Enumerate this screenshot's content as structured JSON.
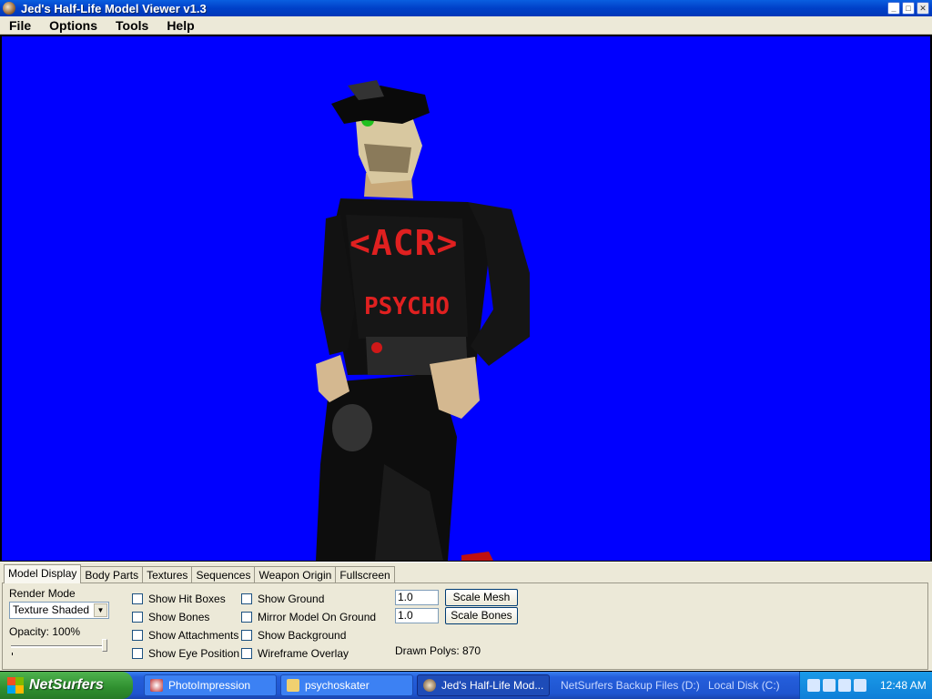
{
  "window": {
    "title": "Jed's Half-Life Model Viewer v1.3"
  },
  "menu": [
    "File",
    "Options",
    "Tools",
    "Help"
  ],
  "tabs": [
    "Model Display",
    "Body Parts",
    "Textures",
    "Sequences",
    "Weapon Origin",
    "Fullscreen"
  ],
  "model_display": {
    "render_mode_label": "Render Mode",
    "render_mode_value": "Texture Shaded",
    "opacity_label": "Opacity: 100%",
    "opacity": 1.0,
    "checkboxes_col1": [
      "Show Hit Boxes",
      "Show Bones",
      "Show Attachments",
      "Show Eye Position"
    ],
    "checkboxes_col2": [
      "Show Ground",
      "Mirror Model On Ground",
      "Show Background",
      "Wireframe Overlay"
    ],
    "scale_mesh_value": "1.0",
    "scale_bones_value": "1.0",
    "scale_mesh_button": "Scale Mesh",
    "scale_bones_button": "Scale Bones",
    "drawn_polys": "Drawn Polys: 870"
  },
  "model_texture_text": {
    "shirt_top": "<ACR>",
    "shirt_bottom": "PSYCHO"
  },
  "taskbar": {
    "start": "NetSurfers",
    "tasks": [
      "PhotoImpression",
      "psychoskater",
      "Jed's Half-Life Mod..."
    ],
    "links": [
      "NetSurfers Backup Files (D:)",
      "Local Disk (C:)"
    ],
    "time": "12:48 AM"
  },
  "colors": {
    "viewport_bg": "#0000ff",
    "title_bar": "#0050d8",
    "panel_bg": "#ece9d8"
  }
}
